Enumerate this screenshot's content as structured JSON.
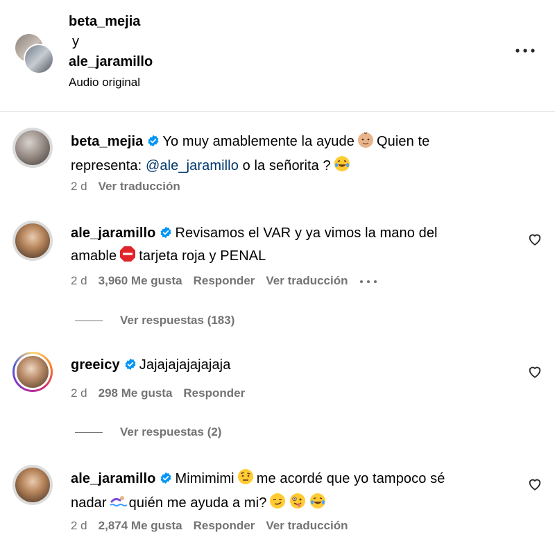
{
  "header": {
    "user1": "beta_mejia",
    "conjunction": "y",
    "user2": "ale_jaramillo",
    "audio": "Audio original",
    "more_icon": "more-horizontal-icon"
  },
  "comments": [
    {
      "username": "beta_mejia",
      "text_a": "Yo muy amablemente la ayude",
      "text_b": "Quien te",
      "text_c": "representa:",
      "mention": "@ale_jaramillo",
      "text_d": "o la señorita ?",
      "time": "2 d",
      "translate": "Ver traducción"
    },
    {
      "username": "ale_jaramillo",
      "text_a": "Revisamos el VAR y ya vimos la mano del",
      "text_b": "amable",
      "text_c": "tarjeta roja y PENAL",
      "time": "2 d",
      "likes": "3,960 Me gusta",
      "reply": "Responder",
      "translate": "Ver traducción",
      "replies": "Ver respuestas (183)"
    },
    {
      "username": "greeicy",
      "text_a": "Jajajajajajajaja",
      "time": "2 d",
      "likes": "298 Me gusta",
      "reply": "Responder",
      "replies": "Ver respuestas (2)"
    },
    {
      "username": "ale_jaramillo",
      "text_a": "Mimimimi",
      "text_b": "me acordé que yo tampoco sé",
      "text_c": "nadar",
      "text_d": "quién me ayuda a mi?",
      "time": "2 d",
      "likes": "2,874 Me gusta",
      "reply": "Responder",
      "translate": "Ver traducción"
    }
  ],
  "colors": {
    "verified": "#0095f6",
    "mention": "#00376b",
    "muted": "#737373"
  }
}
